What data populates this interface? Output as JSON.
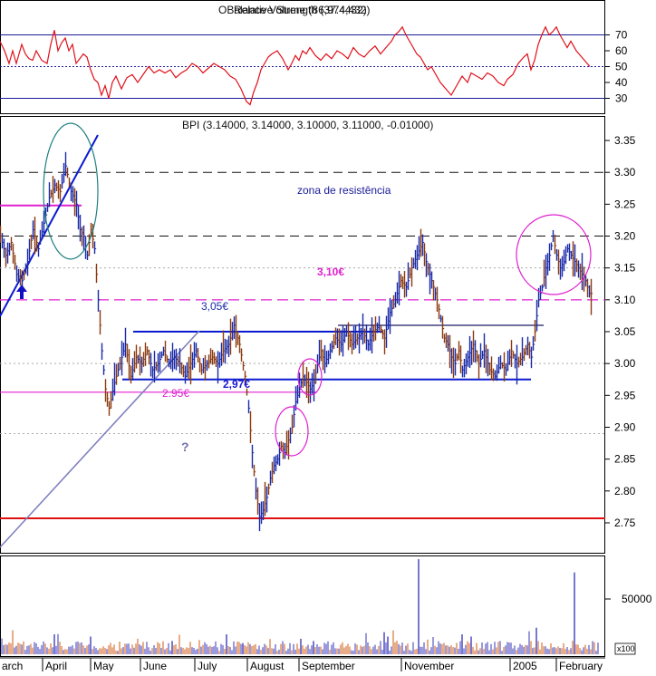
{
  "colors": {
    "frame": "#000000",
    "rsi_line": "#e0101a",
    "rsi_levels": "#1a1a99",
    "up_bar": "#1a2aa8",
    "down_bar": "#8b3a10",
    "blue_line": "#0a1ad0",
    "magenta": "#e020d0",
    "red_support": "#e01010",
    "teal_ellipse": "#208080",
    "gray_trend": "#8080c0",
    "vol_up": "#7878d0",
    "vol_down": "#e09060"
  },
  "rsi_panel": {
    "title_a": "OBalance Volume (86,974,432)",
    "title_b": "Relative Strength (37.4432)",
    "yticks": [
      30,
      40,
      50,
      60,
      70
    ],
    "ylim": [
      20,
      80
    ],
    "levels": [
      30,
      50,
      70
    ]
  },
  "price_panel": {
    "title": "BPI (3.14000, 3.14000, 3.10000, 3.11000, -0.01000)",
    "yticks": [
      "2.75",
      "2.80",
      "2.85",
      "2.90",
      "2.95",
      "3.00",
      "3.05",
      "3.10",
      "3.15",
      "3.20",
      "3.25",
      "3.30",
      "3.35"
    ],
    "annotations": {
      "zona": "zona de resistência",
      "p310": "3,10€",
      "p305": "3,05€",
      "p297": "2,97€",
      "p295": "2.95€",
      "question": "?"
    }
  },
  "volume_panel": {
    "ytick": "50000",
    "unit": "x100"
  },
  "x_axis": {
    "labels": [
      "arch",
      "April",
      "May",
      "June",
      "July",
      "August",
      "September",
      "November",
      "2005",
      "February"
    ]
  },
  "chart_data": {
    "type": "ohlc",
    "rsi": {
      "x": [
        0,
        5,
        10,
        14,
        18,
        24,
        28,
        32,
        36,
        40,
        46,
        52,
        56,
        60,
        64,
        68,
        72,
        76,
        80,
        84,
        88,
        92,
        96,
        100,
        104,
        108,
        112,
        116,
        120,
        124,
        128,
        134,
        140,
        146,
        152,
        158,
        164,
        170,
        176,
        182,
        188,
        194,
        200,
        206,
        212,
        218,
        224,
        230,
        236,
        242,
        248,
        254,
        260,
        266,
        272,
        276,
        280,
        284,
        288,
        292,
        296,
        300,
        306,
        312,
        318,
        322,
        326,
        330,
        334,
        338,
        342,
        348,
        354,
        360,
        366,
        372,
        378,
        384,
        390,
        396,
        402,
        408,
        414,
        420,
        426,
        432,
        436,
        440,
        444,
        448,
        452,
        456,
        460,
        464,
        468,
        472,
        476,
        480,
        486,
        492,
        498,
        504,
        510,
        516,
        520,
        526,
        532,
        538,
        544,
        550,
        556,
        560,
        566,
        572,
        578,
        582,
        586,
        590,
        594,
        598,
        602,
        606,
        610,
        614,
        618,
        622,
        626,
        630,
        636,
        642,
        648,
        651
      ],
      "values": [
        66,
        60,
        52,
        60,
        52,
        64,
        58,
        55,
        54,
        60,
        54,
        52,
        64,
        73,
        60,
        65,
        68,
        60,
        64,
        52,
        55,
        58,
        56,
        48,
        42,
        40,
        32,
        38,
        30,
        40,
        44,
        36,
        43,
        45,
        40,
        45,
        50,
        46,
        48,
        46,
        48,
        43,
        46,
        48,
        52,
        50,
        46,
        49,
        52,
        50,
        48,
        44,
        42,
        36,
        28,
        26,
        34,
        40,
        48,
        52,
        56,
        58,
        60,
        55,
        48,
        52,
        57,
        54,
        60,
        58,
        62,
        57,
        54,
        58,
        55,
        60,
        58,
        55,
        62,
        58,
        56,
        60,
        63,
        58,
        62,
        66,
        70,
        72,
        75,
        70,
        66,
        62,
        58,
        56,
        52,
        48,
        50,
        46,
        40,
        36,
        32,
        38,
        44,
        40,
        46,
        44,
        42,
        46,
        44,
        40,
        38,
        42,
        45,
        52,
        56,
        58,
        48,
        54,
        64,
        70,
        75,
        70,
        72,
        75,
        70,
        66,
        62,
        66,
        60,
        56,
        52,
        50
      ]
    },
    "price_close": {
      "x": [
        0,
        6,
        12,
        18,
        24,
        30,
        36,
        42,
        48,
        54,
        60,
        66,
        72,
        78,
        84,
        88,
        92,
        96,
        100,
        104,
        108,
        112,
        116,
        120,
        126,
        132,
        138,
        144,
        150,
        156,
        162,
        168,
        174,
        180,
        186,
        192,
        198,
        204,
        210,
        216,
        222,
        228,
        234,
        240,
        246,
        252,
        258,
        264,
        270,
        274,
        278,
        282,
        286,
        290,
        294,
        298,
        302,
        306,
        310,
        314,
        318,
        322,
        326,
        330,
        334,
        338,
        342,
        346,
        350,
        354,
        358,
        364,
        370,
        376,
        382,
        388,
        394,
        400,
        406,
        412,
        418,
        424,
        430,
        436,
        442,
        448,
        454,
        460,
        466,
        470,
        474,
        478,
        482,
        486,
        490,
        494,
        498,
        502,
        506,
        510,
        516,
        522,
        528,
        534,
        540,
        546,
        552,
        558,
        564,
        570,
        576,
        582,
        586,
        590,
        594,
        598,
        602,
        606,
        610,
        614,
        618,
        622,
        626,
        630,
        634,
        638,
        642,
        646,
        650,
        654
      ],
      "values": [
        3.2,
        3.17,
        3.19,
        3.14,
        3.13,
        3.16,
        3.21,
        3.18,
        3.22,
        3.26,
        3.28,
        3.27,
        3.31,
        3.27,
        3.25,
        3.21,
        3.2,
        3.17,
        3.21,
        3.18,
        3.1,
        3.02,
        2.96,
        2.93,
        2.97,
        3.0,
        3.03,
        2.98,
        3.01,
        3.0,
        3.02,
        2.99,
        3.0,
        3.02,
        3.0,
        3.01,
        3.0,
        2.98,
        3.0,
        3.02,
        2.99,
        3.0,
        3.01,
        3.0,
        3.02,
        3.03,
        3.06,
        3.03,
        2.98,
        2.93,
        2.86,
        2.8,
        2.76,
        2.77,
        2.79,
        2.82,
        2.84,
        2.85,
        2.87,
        2.86,
        2.88,
        2.9,
        2.94,
        2.96,
        2.98,
        2.97,
        2.96,
        2.97,
        3.0,
        3.02,
        3.0,
        3.02,
        3.04,
        3.03,
        3.05,
        3.03,
        3.04,
        3.05,
        3.03,
        3.05,
        3.06,
        3.04,
        3.08,
        3.1,
        3.13,
        3.12,
        3.15,
        3.17,
        3.19,
        3.16,
        3.14,
        3.12,
        3.1,
        3.07,
        3.04,
        3.03,
        3.01,
        3.0,
        3.02,
        2.99,
        3.01,
        3.03,
        3.0,
        3.02,
        2.99,
        2.98,
        3.0,
        2.99,
        3.02,
        3.0,
        3.01,
        3.03,
        3.01,
        3.05,
        3.1,
        3.12,
        3.15,
        3.17,
        3.2,
        3.17,
        3.15,
        3.16,
        3.18,
        3.17,
        3.16,
        3.15,
        3.14,
        3.13,
        3.11,
        3.11
      ]
    },
    "volume": {
      "x": [
        60,
        100,
        190,
        250,
        268,
        332,
        346,
        424,
        428,
        462,
        510,
        520,
        592,
        634
      ],
      "values": [
        18000,
        16000,
        12000,
        18000,
        10000,
        14000,
        12000,
        20000,
        16000,
        86000,
        18000,
        16000,
        24000,
        74000
      ]
    }
  }
}
